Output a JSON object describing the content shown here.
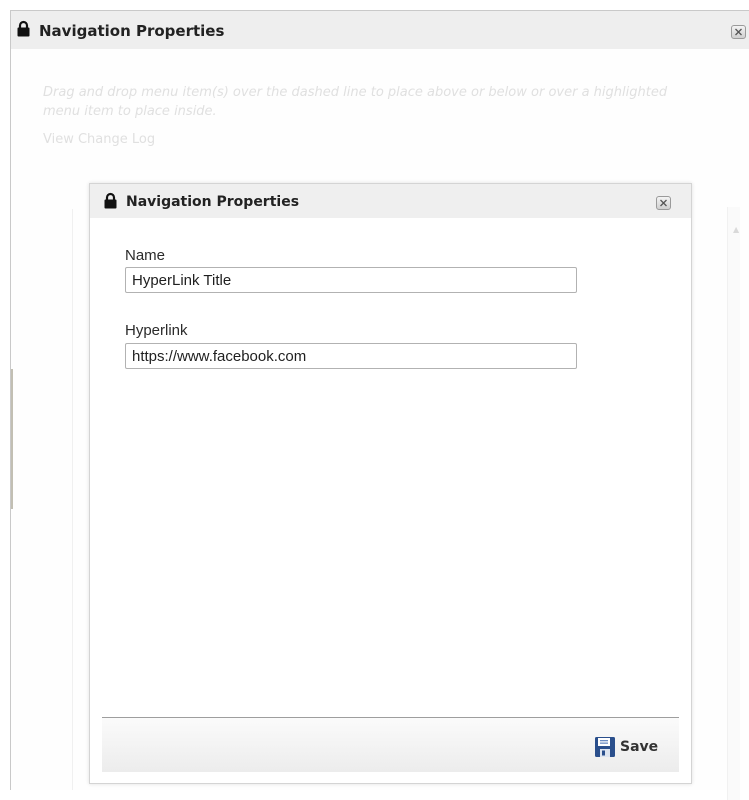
{
  "outer_dialog": {
    "title": "Navigation Properties",
    "instructions": "Drag and drop menu item(s) over the dashed line to place above or below or over a highlighted menu item to place inside.",
    "change_log_link": "View Change Log"
  },
  "inner_dialog": {
    "title": "Navigation Properties",
    "fields": {
      "name": {
        "label": "Name",
        "value": "HyperLink Title"
      },
      "hyperlink": {
        "label": "Hyperlink",
        "value": "https://www.facebook.com"
      }
    },
    "save_label": "Save"
  },
  "icons": {
    "lock": "lock-icon",
    "close": "close-icon",
    "save": "floppy-disk-icon"
  },
  "colors": {
    "header_bg": "#eeeeee",
    "save_icon": "#2a4f8c"
  }
}
